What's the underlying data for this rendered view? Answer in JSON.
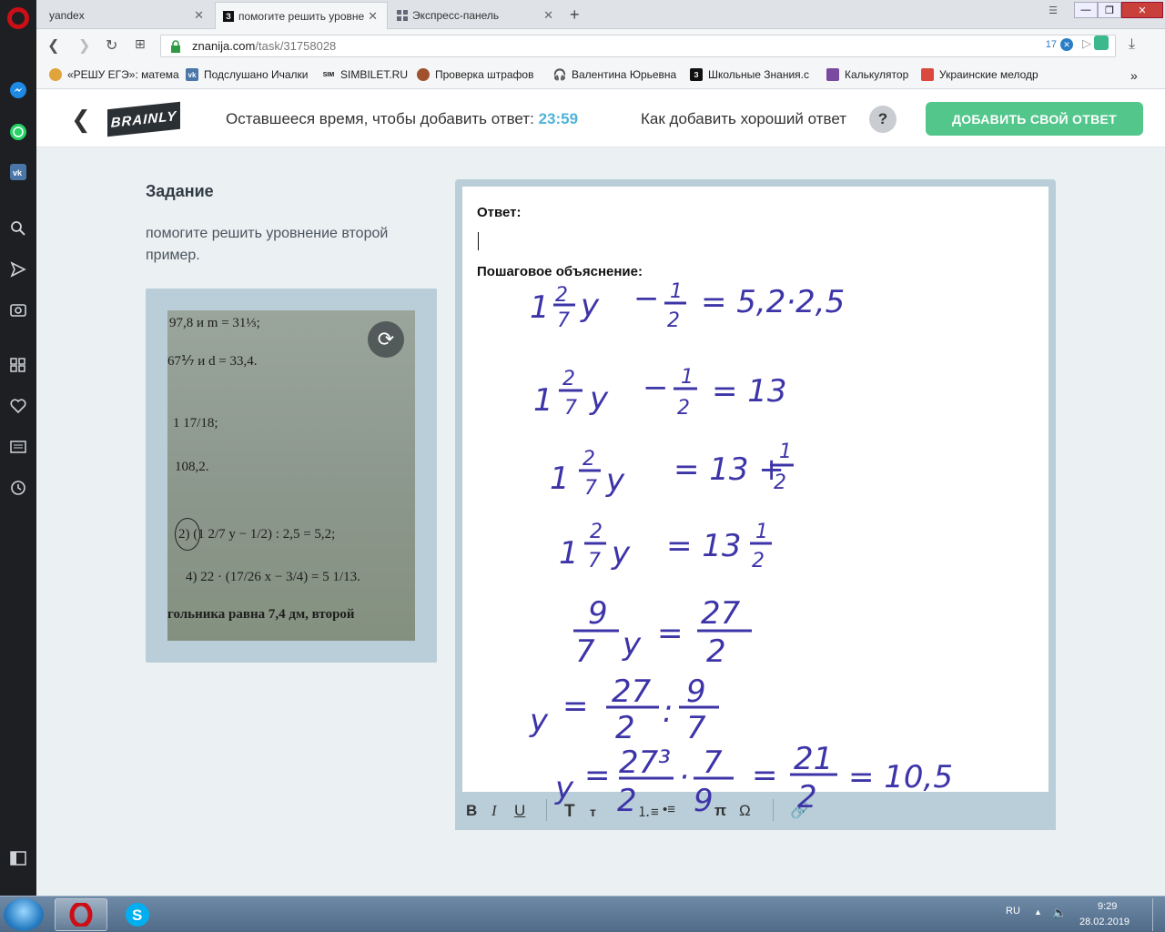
{
  "browser": {
    "tabs": [
      {
        "label": "yandex",
        "active": false
      },
      {
        "label": "помогите решить уровне",
        "active": true
      },
      {
        "label": "Экспресс-панель",
        "active": false
      }
    ],
    "url_domain": "znanija.com",
    "url_path": "/task/31758028",
    "badge_count": "17",
    "bookmarks": [
      {
        "label": "«РЕШУ ЕГЭ»: матема",
        "color": "#e0a43a"
      },
      {
        "label": "Подслушано Ичалки",
        "color": "#4a76a8"
      },
      {
        "label": "SIMBILET.RU",
        "color": "#333333"
      },
      {
        "label": "Проверка штрафов",
        "color": "#a0522d"
      },
      {
        "label": "Валентина Юрьевна",
        "color": "#555555"
      },
      {
        "label": "Школьные Знания.с",
        "color": "#111111"
      },
      {
        "label": "Калькулятор",
        "color": "#7a4aa0"
      },
      {
        "label": "Украинские мелодр",
        "color": "#d9493f"
      }
    ]
  },
  "header": {
    "back_icon": "chevron-left-icon",
    "logo_text": "BRAINLY",
    "timer_label": "Оставшееся время, чтобы добавить ответ:",
    "timer_value": "23:59",
    "howto_label": "Как добавить хороший ответ",
    "help_symbol": "?",
    "add_answer_label": "ДОБАВИТЬ СВОЙ ОТВЕТ",
    "accent_color": "#53c68c",
    "timer_color": "#4fb3d9"
  },
  "task": {
    "title": "Задание",
    "text": "помогите решить уровнение второй пример."
  },
  "photo": {
    "lines": [
      "97,8 и m = 31⅓;",
      "67⅐ и d = 33,4.",
      "1 17/18;",
      "108,2.",
      "2) (1 2/7 y − 1/2) : 2,5 = 5,2;",
      "4) 22 · (17/26 x − 3/4) = 5 1/13.",
      "гольника равна 7,4 дм, второй"
    ]
  },
  "editor": {
    "answer_label": "Ответ:",
    "explanation_label": "Пошаговое объяснение:",
    "handwriting_color": "#3d34a8"
  },
  "toolbar": {
    "bold": "B",
    "italic": "I",
    "underline": "U",
    "text_large": "T",
    "text_small": "т",
    "pi": "π",
    "omega": "Ω"
  },
  "taskbar": {
    "lang": "RU",
    "time": "9:29",
    "date": "28.02.2019"
  }
}
